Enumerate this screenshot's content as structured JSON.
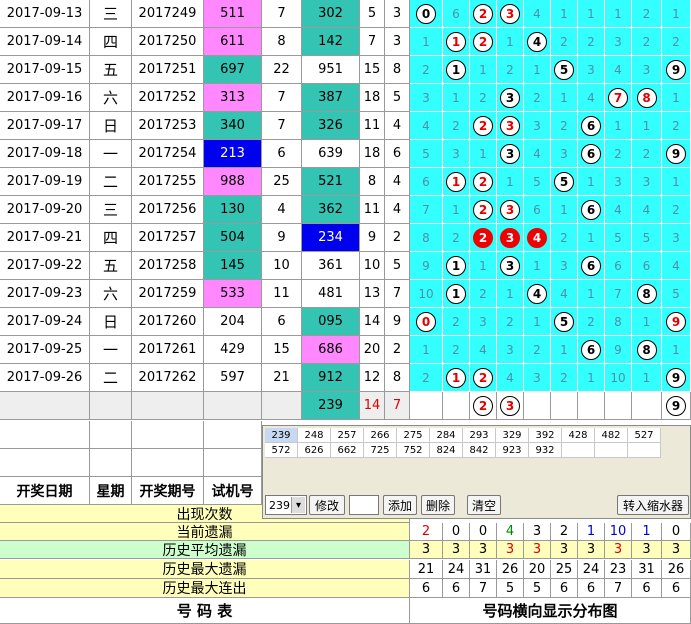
{
  "rows": [
    {
      "date": "2017-09-13",
      "week": "三",
      "issue": "2017249",
      "n1": "511",
      "sum1": "7",
      "n2": "302",
      "sum2": "5",
      "span": "3",
      "dist": [
        "0",
        "6",
        "2",
        "3",
        "4",
        "1",
        "1",
        "1",
        "2",
        "1",
        "9"
      ],
      "balls": {
        "0": "n",
        "2": "r",
        "3": "r"
      }
    },
    {
      "date": "2017-09-14",
      "week": "四",
      "issue": "2017250",
      "n1": "611",
      "sum1": "8",
      "n2": "142",
      "sum2": "7",
      "span": "3",
      "dist": [
        "1",
        "1",
        "2",
        "1",
        "4",
        "2",
        "2",
        "3",
        "2",
        "2",
        "10"
      ],
      "balls": {
        "1": "r",
        "2": "r",
        "4": "n"
      }
    },
    {
      "date": "2017-09-15",
      "week": "五",
      "issue": "2017251",
      "n1": "697",
      "sum1": "22",
      "n2": "951",
      "sum2": "15",
      "span": "8",
      "dist": [
        "2",
        "1",
        "1",
        "2",
        "1",
        "5",
        "3",
        "4",
        "3",
        "9"
      ],
      "balls": {
        "1": "n",
        "5": "n",
        "9": "n"
      }
    },
    {
      "date": "2017-09-16",
      "week": "六",
      "issue": "2017252",
      "n1": "313",
      "sum1": "7",
      "n2": "387",
      "sum2": "18",
      "span": "5",
      "dist": [
        "3",
        "1",
        "2",
        "3",
        "2",
        "1",
        "4",
        "7",
        "8",
        "1"
      ],
      "balls": {
        "3": "n",
        "7": "r",
        "8": "r"
      }
    },
    {
      "date": "2017-09-17",
      "week": "日",
      "issue": "2017253",
      "n1": "340",
      "sum1": "7",
      "n2": "326",
      "sum2": "11",
      "span": "4",
      "dist": [
        "4",
        "2",
        "2",
        "3",
        "3",
        "2",
        "6",
        "1",
        "1",
        "2"
      ],
      "balls": {
        "2": "r",
        "3": "r",
        "6": "n"
      }
    },
    {
      "date": "2017-09-18",
      "week": "一",
      "issue": "2017254",
      "n1": "213",
      "sum1": "6",
      "n2": "639",
      "sum2": "18",
      "span": "6",
      "dist": [
        "5",
        "3",
        "1",
        "3",
        "4",
        "3",
        "6",
        "2",
        "2",
        "9"
      ],
      "balls": {
        "3": "n",
        "6": "n",
        "9": "n"
      }
    },
    {
      "date": "2017-09-19",
      "week": "二",
      "issue": "2017255",
      "n1": "988",
      "sum1": "25",
      "n2": "521",
      "sum2": "8",
      "span": "4",
      "dist": [
        "6",
        "1",
        "2",
        "1",
        "5",
        "5",
        "1",
        "3",
        "3",
        "1"
      ],
      "balls": {
        "1": "r",
        "2": "r",
        "5": "n"
      }
    },
    {
      "date": "2017-09-20",
      "week": "三",
      "issue": "2017256",
      "n1": "130",
      "sum1": "4",
      "n2": "362",
      "sum2": "11",
      "span": "4",
      "dist": [
        "7",
        "1",
        "2",
        "3",
        "6",
        "1",
        "6",
        "4",
        "4",
        "2"
      ],
      "balls": {
        "2": "r",
        "3": "r",
        "6": "n"
      }
    },
    {
      "date": "2017-09-21",
      "week": "四",
      "issue": "2017257",
      "n1": "504",
      "sum1": "9",
      "n2": "234",
      "sum2": "9",
      "span": "2",
      "dist": [
        "8",
        "2",
        "2",
        "3",
        "4",
        "2",
        "1",
        "5",
        "5",
        "3"
      ],
      "balls": {
        "2": "h",
        "3": "h",
        "4": "h"
      }
    },
    {
      "date": "2017-09-22",
      "week": "五",
      "issue": "2017258",
      "n1": "145",
      "sum1": "10",
      "n2": "361",
      "sum2": "10",
      "span": "5",
      "dist": [
        "9",
        "1",
        "1",
        "3",
        "1",
        "3",
        "6",
        "6",
        "6",
        "4"
      ],
      "balls": {
        "1": "n",
        "3": "n",
        "6": "n"
      }
    },
    {
      "date": "2017-09-23",
      "week": "六",
      "issue": "2017259",
      "n1": "533",
      "sum1": "11",
      "n2": "481",
      "sum2": "13",
      "span": "7",
      "dist": [
        "10",
        "1",
        "2",
        "1",
        "4",
        "4",
        "1",
        "7",
        "8",
        "5"
      ],
      "balls": {
        "1": "n",
        "4": "n",
        "8": "n"
      }
    },
    {
      "date": "2017-09-24",
      "week": "日",
      "issue": "2017260",
      "n1": "204",
      "sum1": "6",
      "n2": "095",
      "sum2": "14",
      "span": "9",
      "dist": [
        "0",
        "2",
        "3",
        "2",
        "1",
        "5",
        "2",
        "8",
        "1",
        "9"
      ],
      "balls": {
        "0": "r",
        "5": "n",
        "9": "r"
      }
    },
    {
      "date": "2017-09-25",
      "week": "一",
      "issue": "2017261",
      "n1": "429",
      "sum1": "15",
      "n2": "686",
      "sum2": "20",
      "span": "2",
      "dist": [
        "1",
        "2",
        "4",
        "3",
        "2",
        "1",
        "6",
        "9",
        "8",
        "1"
      ],
      "balls": {
        "6": "n",
        "8": "n"
      }
    },
    {
      "date": "2017-09-26",
      "week": "二",
      "issue": "2017262",
      "n1": "597",
      "sum1": "21",
      "n2": "912",
      "sum2": "12",
      "span": "8",
      "dist": [
        "2",
        "1",
        "2",
        "4",
        "3",
        "2",
        "1",
        "10",
        "1",
        "9"
      ],
      "balls": {
        "1": "r",
        "2": "r",
        "9": "n"
      }
    }
  ],
  "row_bg": {
    "n1": [
      "m",
      "m",
      "t",
      "m",
      "t",
      "b",
      "m",
      "t",
      "t",
      "t",
      "m",
      "w",
      "w",
      "w"
    ],
    "n2": [
      "t",
      "t",
      "w",
      "t",
      "t",
      "w",
      "t",
      "t",
      "b",
      "w",
      "w",
      "t",
      "m",
      "t"
    ]
  },
  "predict_row": {
    "n2": "239",
    "sum2": "14",
    "span": "7",
    "balls": {
      "2": "r",
      "3": "r",
      "9": "n"
    }
  },
  "header": {
    "date": "开奖日期",
    "week": "星期",
    "issue": "开奖期号",
    "trial": "试机号"
  },
  "stats": {
    "appear_label": "出现次数",
    "current_label": "当前遗漏",
    "current": [
      "2",
      "0",
      "0",
      "4",
      "3",
      "2",
      "1",
      "10",
      "1",
      "0"
    ],
    "avg_label": "历史平均遗漏",
    "avg": [
      "3",
      "3",
      "3",
      "3",
      "3",
      "3",
      "3",
      "3",
      "3",
      "3"
    ],
    "max_label": "历史最大遗漏",
    "max": [
      "21",
      "24",
      "31",
      "26",
      "20",
      "25",
      "24",
      "23",
      "31",
      "26"
    ],
    "streak_label": "历史最大连出",
    "streak": [
      "6",
      "6",
      "7",
      "5",
      "5",
      "6",
      "6",
      "7",
      "6",
      "6"
    ]
  },
  "footer": {
    "left": "号   码   表",
    "right": "号码横向显示分布图"
  },
  "panel": {
    "grid": [
      [
        "239",
        "248",
        "257",
        "266",
        "275",
        "284",
        "293",
        "329",
        "392",
        "428",
        "482",
        "527"
      ],
      [
        "572",
        "626",
        "662",
        "725",
        "752",
        "824",
        "842",
        "923",
        "932",
        "",
        "",
        ""
      ]
    ],
    "select_value": "239",
    "input_value": "",
    "buttons": {
      "modify": "修改",
      "add": "添加",
      "delete": "删除",
      "clear": "清空",
      "shrink": "转入缩水器"
    }
  },
  "colors": {
    "magenta": "#ff88ff",
    "teal": "#33c4b4",
    "blue": "#0000ee",
    "cyan": "#33ffff",
    "red": "#f00000"
  }
}
